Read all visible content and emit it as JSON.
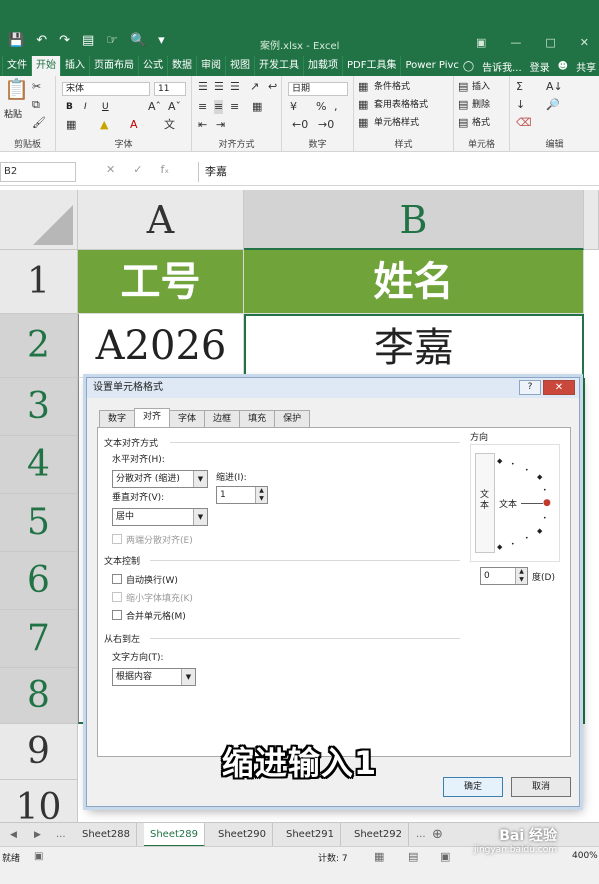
{
  "app": {
    "window_title": "案例.xlsx - Excel",
    "accent_color": "#217346"
  },
  "ribbon_tabs": [
    "文件",
    "开始",
    "插入",
    "页面布局",
    "公式",
    "数据",
    "审阅",
    "视图",
    "开发工具",
    "加载项",
    "PDF工具集",
    "Power Pivc"
  ],
  "ribbon_right": {
    "tell_me": "告诉我...",
    "login": "登录",
    "share": "共享"
  },
  "ribbon": {
    "clipboard": {
      "paste": "粘贴",
      "label": "剪贴板"
    },
    "font": {
      "name": "宋体",
      "size": "11",
      "bold": "B",
      "italic": "I",
      "underline": "U",
      "label": "字体"
    },
    "alignment": {
      "label": "对齐方式"
    },
    "number": {
      "format": "日期",
      "label": "数字"
    },
    "styles": {
      "conditional": "条件格式",
      "table": "套用表格格式",
      "cell_styles": "单元格样式",
      "label": "样式"
    },
    "cells": {
      "insert": "插入",
      "delete": "删除",
      "format": "格式",
      "label": "单元格"
    },
    "editing": {
      "label": "编辑"
    }
  },
  "formula_bar": {
    "name_box": "B2",
    "content": "李嘉"
  },
  "grid": {
    "columns": [
      "A",
      "B"
    ],
    "rows": [
      "1",
      "2",
      "3",
      "4",
      "5",
      "6",
      "7",
      "8",
      "9",
      "10"
    ],
    "header_row": {
      "A": "工号",
      "B": "姓名"
    },
    "row2": {
      "A": "A2026",
      "B": "李嘉"
    },
    "header_fill": "#70a33a"
  },
  "dialog": {
    "title": "设置单元格格式",
    "help": "?",
    "close": "✕",
    "tabs": [
      "数字",
      "对齐",
      "字体",
      "边框",
      "填充",
      "保护"
    ],
    "active_tab": "对齐",
    "text_alignment": {
      "section": "文本对齐方式",
      "horizontal_label": "水平对齐(H):",
      "horizontal_value": "分散对齐 (缩进)",
      "indent_label": "缩进(I):",
      "indent_value": "1",
      "vertical_label": "垂直对齐(V):",
      "vertical_value": "居中",
      "justify_distributed": "两端分散对齐(E)"
    },
    "text_control": {
      "section": "文本控制",
      "wrap": "自动换行(W)",
      "shrink": "缩小字体填充(K)",
      "merge": "合并单元格(M)"
    },
    "rtl": {
      "section": "从右到左",
      "direction_label": "文字方向(T):",
      "direction_value": "根据内容"
    },
    "orientation": {
      "section": "方向",
      "vertical_text": "文本",
      "dial_text": "文本",
      "degrees_value": "0",
      "degrees_label": "度(D)"
    },
    "ok": "确定",
    "cancel": "取消"
  },
  "caption": "缩进输入1",
  "sheets": {
    "nav_more": "...",
    "tabs": [
      "Sheet288",
      "Sheet289",
      "Sheet290",
      "Sheet291",
      "Sheet292"
    ],
    "active": "Sheet289",
    "more_right": "..."
  },
  "status": {
    "ready": "就绪",
    "count": "计数: 7",
    "zoom": "400%"
  },
  "watermark": {
    "brand": "Bai 经验",
    "url": "jingyan.baidu.com"
  }
}
